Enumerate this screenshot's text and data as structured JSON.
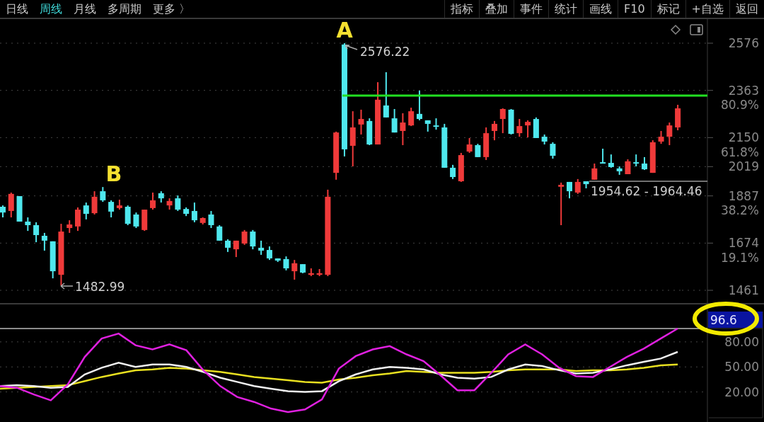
{
  "tabs": [
    {
      "label": "日线",
      "selected": false
    },
    {
      "label": "周线",
      "selected": true
    },
    {
      "label": "月线",
      "selected": false
    },
    {
      "label": "多周期",
      "selected": false
    },
    {
      "label": "更多 〉",
      "selected": false
    }
  ],
  "toolbar_buttons": [
    "指标",
    "叠加",
    "事件",
    "统计",
    "画线",
    "F10",
    "标记",
    "+自选",
    "返回"
  ],
  "chart": {
    "markers": [
      "A",
      "B"
    ],
    "high_label": "2576.22",
    "low_label": "1482.99",
    "range_label": "1954.62 - 1964.46",
    "ratio_labels": [
      "80.9%",
      "61.8%",
      "38.2%",
      "19.1%"
    ],
    "chart_data": {
      "type": "candlestick",
      "categories": [
        null,
        null,
        null,
        null,
        null,
        null,
        null,
        null,
        null,
        null,
        null,
        null,
        null,
        null,
        null,
        null,
        null,
        null,
        null,
        null,
        null,
        null,
        null,
        null,
        null,
        null,
        null,
        null,
        null,
        null,
        null,
        null,
        null,
        null,
        null,
        null,
        null,
        null,
        null,
        null,
        null,
        null,
        null,
        null,
        null,
        null,
        null,
        null,
        null,
        null,
        null,
        null,
        null,
        null,
        null,
        null,
        null,
        null,
        null,
        null,
        null,
        null,
        null,
        null,
        null,
        null,
        null,
        null,
        null,
        null,
        null,
        null,
        null,
        null,
        null,
        null,
        null,
        null,
        null,
        null,
        null,
        null
      ],
      "ylim": [
        1461,
        2576
      ],
      "grid": true,
      "yticks": [
        2576,
        2363,
        2150,
        2019,
        1887,
        1674,
        1461
      ],
      "ohlc": [
        [
          1838,
          1844,
          1790,
          1812
        ],
        [
          1819,
          1902,
          1790,
          1896
        ],
        [
          1886,
          1886,
          1771,
          1771
        ],
        [
          1771,
          1790,
          1729,
          1755
        ],
        [
          1755,
          1768,
          1678,
          1710
        ],
        [
          1707,
          1720,
          1640,
          1685
        ],
        [
          1682,
          1682,
          1515,
          1547
        ],
        [
          1531,
          1761,
          1483,
          1726
        ],
        [
          1742,
          1777,
          1720,
          1758
        ],
        [
          1749,
          1835,
          1729,
          1825
        ],
        [
          1844,
          1857,
          1781,
          1806
        ],
        [
          1809,
          1908,
          1803,
          1883
        ],
        [
          1908,
          1927,
          1860,
          1867
        ],
        [
          1860,
          1867,
          1790,
          1816
        ],
        [
          1832,
          1870,
          1825,
          1844
        ],
        [
          1838,
          1844,
          1755,
          1761
        ],
        [
          1803,
          1812,
          1742,
          1749
        ],
        [
          1733,
          1825,
          1729,
          1825
        ],
        [
          1832,
          1902,
          1825,
          1867
        ],
        [
          1899,
          1908,
          1857,
          1876
        ],
        [
          1844,
          1876,
          1825,
          1864
        ],
        [
          1876,
          1889,
          1819,
          1825
        ],
        [
          1828,
          1835,
          1796,
          1806
        ],
        [
          1819,
          1857,
          1768,
          1777
        ],
        [
          1765,
          1790,
          1758,
          1787
        ],
        [
          1803,
          1819,
          1742,
          1755
        ],
        [
          1749,
          1755,
          1685,
          1685
        ],
        [
          1685,
          1691,
          1634,
          1653
        ],
        [
          1646,
          1685,
          1611,
          1685
        ],
        [
          1672,
          1733,
          1666,
          1726
        ],
        [
          1726,
          1733,
          1646,
          1659
        ],
        [
          1653,
          1685,
          1621,
          1640
        ],
        [
          1643,
          1659,
          1598,
          1605
        ],
        [
          1605,
          1605,
          1589,
          1595
        ],
        [
          1602,
          1614,
          1551,
          1560
        ],
        [
          1547,
          1598,
          1509,
          1583
        ],
        [
          1579,
          1579,
          1538,
          1541
        ],
        [
          1531,
          1560,
          1525,
          1538
        ],
        [
          1531,
          1557,
          1525,
          1538
        ],
        [
          1531,
          1915,
          1525,
          1883
        ],
        [
          1991,
          2177,
          1960,
          2173
        ],
        [
          2570,
          2576,
          2065,
          2097
        ],
        [
          2113,
          2269,
          2020,
          2196
        ],
        [
          2209,
          2276,
          2164,
          2234
        ],
        [
          2225,
          2237,
          2116,
          2119
        ],
        [
          2119,
          2400,
          2119,
          2321
        ],
        [
          2295,
          2445,
          2241,
          2241
        ],
        [
          2237,
          2279,
          2173,
          2173
        ],
        [
          2180,
          2260,
          2116,
          2218
        ],
        [
          2205,
          2285,
          2202,
          2269
        ],
        [
          2257,
          2362,
          2228,
          2234
        ],
        [
          2228,
          2228,
          2177,
          2212
        ],
        [
          2205,
          2237,
          2186,
          2202
        ],
        [
          2196,
          2212,
          2014,
          2014
        ],
        [
          2014,
          2027,
          1963,
          1972
        ],
        [
          1953,
          2081,
          1950,
          2071
        ],
        [
          2087,
          2148,
          2081,
          2119
        ],
        [
          2116,
          2122,
          2062,
          2062
        ],
        [
          2062,
          2196,
          2049,
          2170
        ],
        [
          2180,
          2225,
          2138,
          2212
        ],
        [
          2234,
          2282,
          2170,
          2279
        ],
        [
          2276,
          2279,
          2164,
          2167
        ],
        [
          2170,
          2234,
          2154,
          2202
        ],
        [
          2205,
          2228,
          2151,
          2221
        ],
        [
          2234,
          2241,
          2148,
          2148
        ],
        [
          2154,
          2164,
          2119,
          2132
        ],
        [
          2122,
          2129,
          2055,
          2068
        ],
        [
          1928,
          1947,
          1755,
          1937
        ],
        [
          1950,
          1950,
          1876,
          1908
        ],
        [
          1902,
          1963,
          1896,
          1950
        ],
        [
          1953,
          1953,
          1921,
          1940
        ],
        [
          1960,
          2033,
          1960,
          2011
        ],
        [
          2039,
          2100,
          2033,
          2033
        ],
        [
          2036,
          2074,
          2014,
          2017
        ],
        [
          2011,
          2020,
          1982,
          1998
        ],
        [
          1985,
          2052,
          1985,
          2043
        ],
        [
          2039,
          2074,
          2020,
          2033
        ],
        [
          2033,
          2062,
          2004,
          2007
        ],
        [
          1991,
          2138,
          1991,
          2129
        ],
        [
          2132,
          2180,
          2122,
          2154
        ],
        [
          2154,
          2218,
          2116,
          2205
        ],
        [
          2196,
          2298,
          2183,
          2282
        ]
      ]
    }
  },
  "indicator": {
    "value": "96.6",
    "chart_data": {
      "type": "line",
      "categories": [
        null,
        null,
        null,
        null,
        null,
        null,
        null,
        null,
        null,
        null,
        null,
        null,
        null,
        null,
        null,
        null,
        null,
        null,
        null,
        null,
        null,
        null,
        null,
        null,
        null,
        null,
        null,
        null,
        null,
        null,
        null,
        null,
        null,
        null,
        null,
        null,
        null,
        null,
        null,
        null,
        null
      ],
      "ylim": [
        -16,
        96
      ],
      "grid": true,
      "yticks": [
        {
          "value": 80,
          "label": "80.00"
        },
        {
          "value": 50,
          "label": "50.00"
        },
        {
          "value": 20,
          "label": "20.00"
        }
      ],
      "series": [
        {
          "color": "#e8e020",
          "values": [
            24,
            25,
            26,
            27,
            28,
            33,
            38,
            42,
            46,
            47,
            49,
            48,
            46,
            44,
            41,
            38,
            36,
            34,
            32,
            31,
            35,
            37,
            40,
            42,
            45,
            44,
            43,
            43,
            43,
            44,
            46,
            47,
            47,
            47,
            45,
            46,
            46,
            47,
            49,
            52,
            53
          ]
        },
        {
          "color": "#f0f0f0",
          "values": [
            27,
            28,
            27,
            25,
            26,
            41,
            49,
            55,
            50,
            53,
            53,
            50,
            44,
            37,
            32,
            27,
            24,
            21,
            20,
            21,
            33,
            41,
            47,
            50,
            49,
            47,
            41,
            37,
            36,
            38,
            47,
            53,
            51,
            46,
            42,
            43,
            47,
            52,
            56,
            60,
            68
          ]
        },
        {
          "color": "#e020e0",
          "values": [
            27,
            25,
            17,
            10,
            29,
            62,
            84,
            90,
            76,
            71,
            77,
            70,
            46,
            27,
            14,
            8,
            0,
            -4,
            -1,
            11,
            48,
            63,
            71,
            75,
            65,
            57,
            40,
            22,
            22,
            43,
            65,
            77,
            65,
            49,
            39,
            38,
            50,
            62,
            72,
            84,
            96
          ]
        }
      ]
    }
  }
}
